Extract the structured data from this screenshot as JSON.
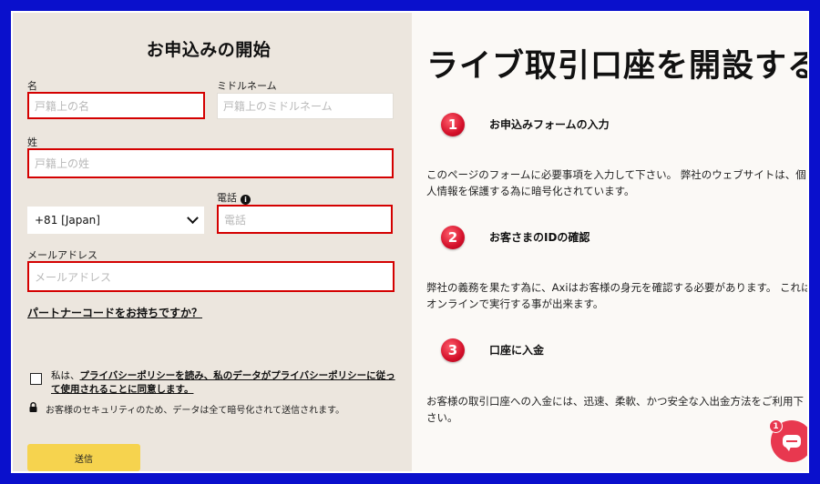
{
  "form": {
    "title": "お申込みの開始",
    "first_name": {
      "label": "名",
      "placeholder": "戸籍上の名"
    },
    "middle_name": {
      "label": "ミドルネーム",
      "placeholder": "戸籍上のミドルネーム"
    },
    "last_name": {
      "label": "姓",
      "placeholder": "戸籍上の姓"
    },
    "country_code": {
      "value": "+81 [Japan]"
    },
    "phone": {
      "label": "電話",
      "placeholder": "電話",
      "info": "i"
    },
    "email": {
      "label": "メールアドレス",
      "placeholder": "メールアドレス"
    },
    "partner_link": "パートナーコードをお持ちですか？",
    "consent": {
      "prefix": "私は、",
      "link_text": "プライバシーポリシーを読み、私のデータがプライバシーポリシーに従って使用されることに同意します。"
    },
    "security_note": "お客様のセキュリティのため、データは全て暗号化されて送信されます。",
    "submit_label": "送信"
  },
  "info": {
    "title": "ライブ取引口座を開設する",
    "steps": [
      {
        "number": "1",
        "title": "お申込みフォームの入力",
        "text": "このページのフォームに必要事項を入力して下さい。 弊社のウェブサイトは、個人情報を保護する為に暗号化されています。"
      },
      {
        "number": "2",
        "title": "お客さまのIDの確認",
        "text": "弊社の義務を果たす為に、Axiはお客様の身元を確認する必要があります。 これはオンラインで実行する事が出来ます。"
      },
      {
        "number": "3",
        "title": "口座に入金",
        "text": "お客様の取引口座への入金には、迅速、柔軟、かつ安全な入出金方法をご利用下さい。"
      }
    ]
  },
  "chat": {
    "badge_count": "1"
  },
  "colors": {
    "highlight_border": "#d40000",
    "submit_bg": "#f6d34e",
    "step_red": "#d4102a",
    "frame_blue": "#0a10cc"
  }
}
